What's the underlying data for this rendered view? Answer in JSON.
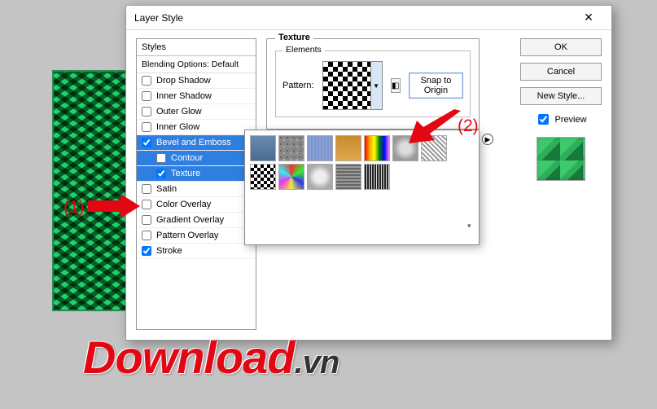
{
  "dialog": {
    "title": "Layer Style",
    "close": "✕",
    "styles_head": "Styles",
    "blending_head": "Blending Options: Default",
    "items": [
      {
        "label": "Drop Shadow",
        "checked": false,
        "selected": false,
        "indent": false
      },
      {
        "label": "Inner Shadow",
        "checked": false,
        "selected": false,
        "indent": false
      },
      {
        "label": "Outer Glow",
        "checked": false,
        "selected": false,
        "indent": false
      },
      {
        "label": "Inner Glow",
        "checked": false,
        "selected": false,
        "indent": false
      },
      {
        "label": "Bevel and Emboss",
        "checked": true,
        "selected": true,
        "indent": false
      },
      {
        "label": "Contour",
        "checked": false,
        "selected": true,
        "indent": true
      },
      {
        "label": "Texture",
        "checked": true,
        "selected": true,
        "indent": true
      },
      {
        "label": "Satin",
        "checked": false,
        "selected": false,
        "indent": false
      },
      {
        "label": "Color Overlay",
        "checked": false,
        "selected": false,
        "indent": false
      },
      {
        "label": "Gradient Overlay",
        "checked": false,
        "selected": false,
        "indent": false
      },
      {
        "label": "Pattern Overlay",
        "checked": false,
        "selected": false,
        "indent": false
      },
      {
        "label": "Stroke",
        "checked": true,
        "selected": false,
        "indent": false
      }
    ]
  },
  "texture": {
    "legend": "Texture",
    "inner_legend": "Elements",
    "pattern_label": "Pattern:",
    "snap_btn": "Snap to Origin"
  },
  "buttons": {
    "ok": "OK",
    "cancel": "Cancel",
    "new_style": "New Style...",
    "preview": "Preview"
  },
  "annotations": {
    "a1": "(1)",
    "a2": "(2)"
  },
  "watermark": {
    "main": "Download",
    "suffix": ".vn"
  }
}
